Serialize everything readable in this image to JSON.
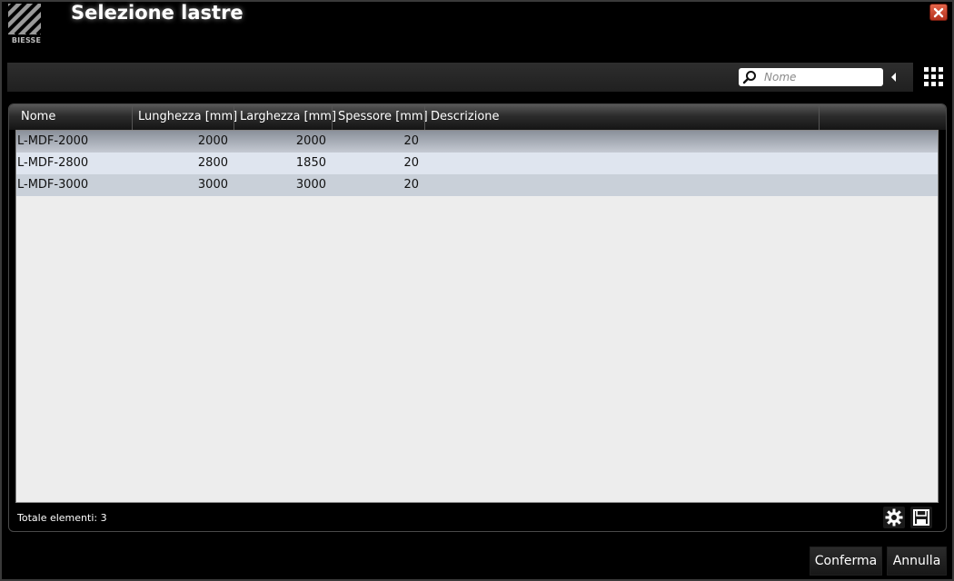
{
  "window": {
    "title": "Selezione lastre",
    "logo_text": "BIESSE"
  },
  "search": {
    "placeholder": "Nome"
  },
  "table": {
    "columns": [
      "Nome",
      "Lunghezza [mm]",
      "Larghezza [mm]",
      "Spessore [mm]",
      "Descrizione"
    ],
    "rows": [
      {
        "nome": "L-MDF-2000",
        "lunghezza": "2000",
        "larghezza": "2000",
        "spessore": "20",
        "descrizione": ""
      },
      {
        "nome": "L-MDF-2800",
        "lunghezza": "2800",
        "larghezza": "1850",
        "spessore": "20",
        "descrizione": ""
      },
      {
        "nome": "L-MDF-3000",
        "lunghezza": "3000",
        "larghezza": "3000",
        "spessore": "20",
        "descrizione": ""
      }
    ]
  },
  "footer": {
    "total_label": "Totale elementi: 3"
  },
  "buttons": {
    "confirm": "Conferma",
    "cancel": "Annulla"
  },
  "icons": {
    "logo": "biesse-logo-icon",
    "close": "close-icon",
    "search": "search-icon",
    "collapse": "chevron-left-icon",
    "view_grid": "grid-icon",
    "settings": "gear-icon",
    "save": "floppy-save-icon"
  },
  "colors": {
    "close_button": "#c0392b",
    "selected_row": "#8a909a",
    "row_alt_light": "#dfe5ef",
    "row_alt_dark": "#c9d0d9",
    "grid_background": "#ededed"
  }
}
